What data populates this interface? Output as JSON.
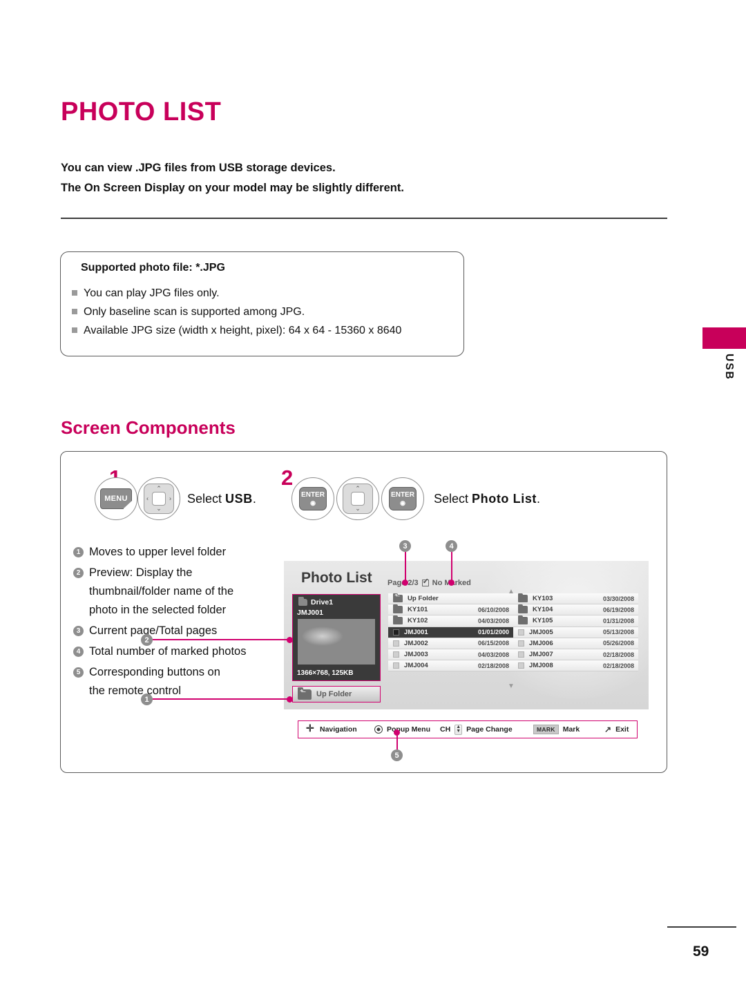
{
  "page": {
    "title": "PHOTO LIST",
    "intro_lines": [
      "You can view .JPG files from USB storage devices.",
      "The On Screen Display on your model may be slightly different."
    ],
    "page_number": "59",
    "side_tab": "USB",
    "accent_color": "#C8005A",
    "callout_color": "#D0006E"
  },
  "supported": {
    "title": "Supported photo file: *.JPG",
    "items": [
      "You can play JPG files only.",
      "Only baseline scan is supported among JPG.",
      "Available JPG size (width x height, pixel): 64 x 64 - 15360 x 8640"
    ]
  },
  "section": {
    "heading": "Screen Components"
  },
  "steps": [
    {
      "number": "1",
      "keys": [
        "MENU",
        "nav-4way"
      ],
      "label_prefix": "Select ",
      "label_bold": "USB",
      "label_suffix": "."
    },
    {
      "number": "2",
      "keys": [
        "ENTER",
        "nav-updown",
        "ENTER"
      ],
      "label_prefix": "Select ",
      "label_bold": "Photo List",
      "label_suffix": "."
    }
  ],
  "key_labels": {
    "menu": "MENU",
    "enter": "ENTER"
  },
  "legend": [
    {
      "num": "1",
      "text": "Moves to upper level folder"
    },
    {
      "num": "2",
      "text": "Preview: Display the thumbnail/folder name of the photo in the selected folder"
    },
    {
      "num": "3",
      "text": "Current page/Total pages"
    },
    {
      "num": "4",
      "text": "Total number of marked photos"
    },
    {
      "num": "5",
      "text": "Corresponding buttons on the remote control"
    }
  ],
  "tv": {
    "title": "Photo List",
    "page_info": "Page 2/3",
    "marked_info": "No Marked",
    "preview": {
      "drive": "Drive1",
      "file": "JMJ001",
      "meta": "1366×768, 125KB"
    },
    "up_folder_button": "Up Folder",
    "left_column": [
      {
        "name": "Up Folder",
        "date": "",
        "type": "upfolder"
      },
      {
        "name": "KY101",
        "date": "06/10/2008",
        "type": "folder"
      },
      {
        "name": "KY102",
        "date": "04/03/2008",
        "type": "folder"
      },
      {
        "name": "JMJ001",
        "date": "01/01/2000",
        "type": "file",
        "selected": true
      },
      {
        "name": "JMJ002",
        "date": "06/15/2008",
        "type": "file"
      },
      {
        "name": "JMJ003",
        "date": "04/03/2008",
        "type": "file"
      },
      {
        "name": "JMJ004",
        "date": "02/18/2008",
        "type": "file"
      }
    ],
    "right_column": [
      {
        "name": "KY103",
        "date": "03/30/2008",
        "type": "folder"
      },
      {
        "name": "KY104",
        "date": "06/19/2008",
        "type": "folder"
      },
      {
        "name": "KY105",
        "date": "01/31/2008",
        "type": "folder"
      },
      {
        "name": "JMJ005",
        "date": "05/13/2008",
        "type": "file"
      },
      {
        "name": "JMJ006",
        "date": "05/26/2008",
        "type": "file"
      },
      {
        "name": "JMJ007",
        "date": "02/18/2008",
        "type": "file"
      },
      {
        "name": "JMJ008",
        "date": "02/18/2008",
        "type": "file"
      }
    ],
    "navbar": [
      {
        "icon": "four-way-arrows-icon",
        "label": "Navigation"
      },
      {
        "icon": "enter-circle-icon",
        "label": "Popup Menu"
      },
      {
        "icon": "ch-updown-icon",
        "prefix": "CH",
        "label": "Page Change"
      },
      {
        "icon": "mark-key-icon",
        "key": "MARK",
        "label": "Mark"
      },
      {
        "icon": "exit-icon",
        "label": "Exit"
      }
    ]
  }
}
